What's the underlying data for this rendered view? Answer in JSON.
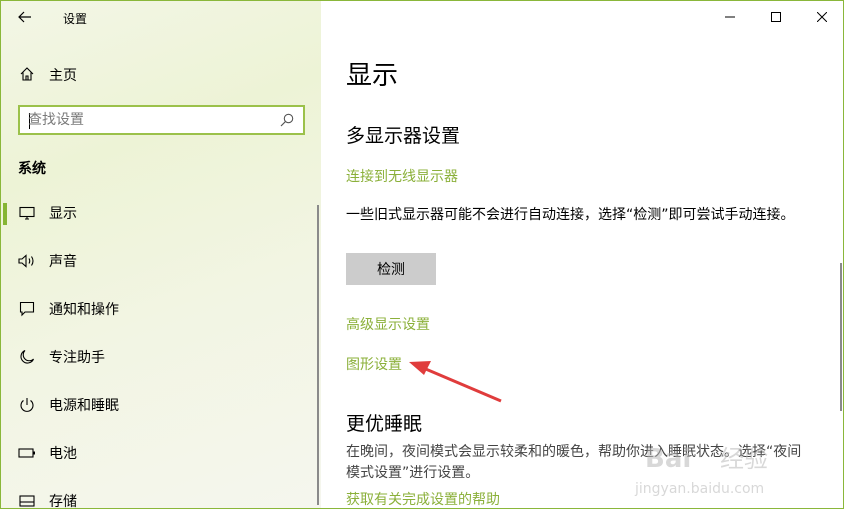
{
  "window": {
    "app_title": "设置",
    "accent_color": "#8bb03a"
  },
  "sidebar": {
    "home_label": "主页",
    "search": {
      "placeholder": "查找设置"
    },
    "section_heading": "系统",
    "items": [
      {
        "label": "显示",
        "icon": "monitor-icon",
        "active": true
      },
      {
        "label": "声音",
        "icon": "speaker-icon"
      },
      {
        "label": "通知和操作",
        "icon": "notification-icon"
      },
      {
        "label": "专注助手",
        "icon": "moon-icon"
      },
      {
        "label": "电源和睡眠",
        "icon": "power-icon"
      },
      {
        "label": "电池",
        "icon": "battery-icon"
      },
      {
        "label": "存储",
        "icon": "storage-icon"
      }
    ]
  },
  "main": {
    "page_title": "显示",
    "multi_display": {
      "heading": "多显示器设置",
      "connect_link": "连接到无线显示器",
      "description": "一些旧式显示器可能不会进行自动连接，选择“检测”即可尝试手动连接。",
      "detect_button": "检测"
    },
    "advanced_link": "高级显示设置",
    "graphics_link": "图形设置",
    "sleep": {
      "heading": "更优睡眠",
      "description": "在晚间，夜间模式会显示较柔和的暖色，帮助你进入睡眠状态。选择“夜间模式设置”进行设置。",
      "help_link": "获取有关完成设置的帮助"
    }
  },
  "watermark": {
    "text": "Bai 经验",
    "url": "jingyan.baidu.com"
  }
}
